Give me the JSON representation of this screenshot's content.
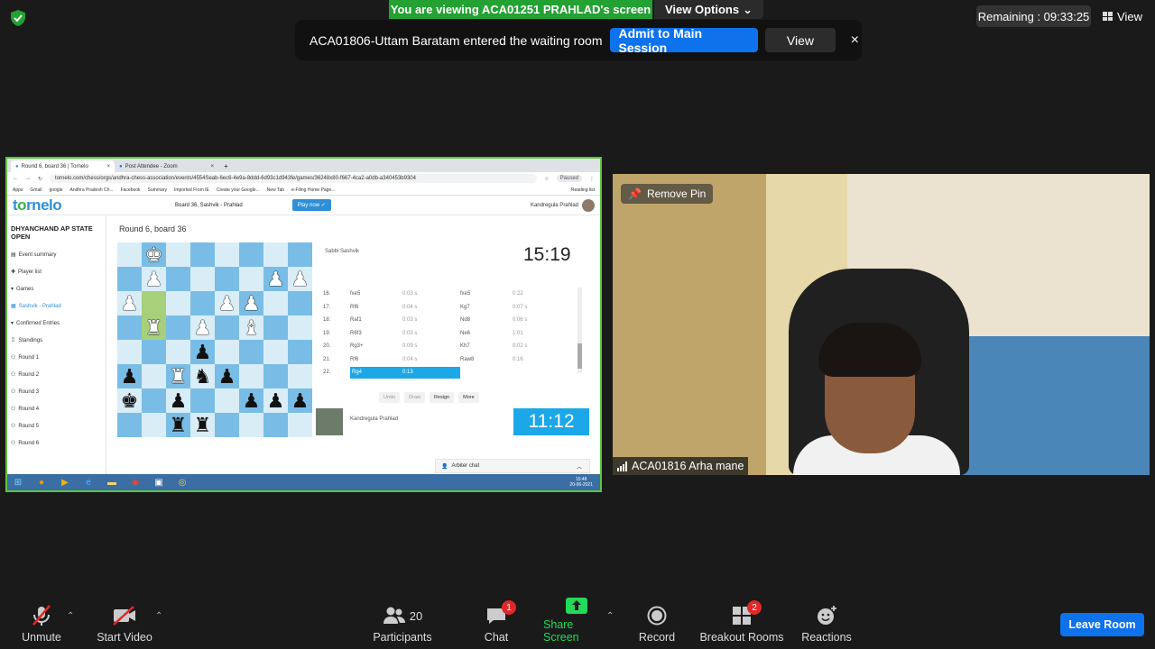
{
  "top": {
    "viewing_banner": "You are viewing ACA01251 PRAHLAD's screen",
    "view_options": "View Options",
    "remaining": "Remaining : 09:33:25",
    "view": "View"
  },
  "notice": {
    "message": "ACA01806-Uttam Baratam entered the waiting room",
    "admit": "Admit to Main Session",
    "view": "View",
    "close": "×"
  },
  "browser": {
    "tabs": [
      "Round 6, board 36 | Tornelo",
      "Post Attendee - Zoom"
    ],
    "tab_close": "×",
    "new_tab": "+",
    "url": "tornelo.com/chess/orgs/andhra-chess-association/events/4554Seab-6ec6-4e9a-8ddd-6d93c1d943fe/games/36248x80-f667-4ca2-a0db-a340453b9304",
    "paused": "Paused",
    "bookmarks": [
      "Apps",
      "Gmail",
      "google",
      "Andhra Pradesh Ch...",
      "Facebook",
      "Summary",
      "Imported From IE",
      "Create your Google...",
      "New Tab",
      "e-Filing Home Page...",
      "Reading list"
    ]
  },
  "site": {
    "logo_prefix": "t",
    "logo_o": "o",
    "logo_suffix": "rnelo",
    "board_title": "Board 36, Sashvik - Prahlad",
    "play_now": "Play now ✓",
    "user": "Kandregula Prahlad",
    "event": "DHYANCHAND AP STATE OPEN",
    "sidebar": [
      "Event summary",
      "Player list",
      "Games",
      "Sashvik - Prahlad",
      "Confirmed Entries",
      "Standings",
      "Round 1",
      "Round 2",
      "Round 3",
      "Round 4",
      "Round 5",
      "Round 6"
    ],
    "round_title": "Round 6, board 36",
    "opponent": "Sabbi Sashvik",
    "clock_top": "15:19",
    "me": "Kandregula Prahlad",
    "clock_bottom": "11:12",
    "controls": [
      "Undo",
      "Draw",
      "Resign",
      "More"
    ],
    "arbiter": "Arbiter chat",
    "moves": [
      {
        "n": "16.",
        "w": "fxe5",
        "wt": "0:03 s",
        "b": "fxe5",
        "bt": "0:22"
      },
      {
        "n": "17.",
        "w": "Rf6",
        "wt": "0:04 s",
        "b": "Kg7",
        "bt": "0:07 s"
      },
      {
        "n": "18.",
        "w": "Raf1",
        "wt": "0:03 s",
        "b": "Nd8",
        "bt": "0:06 s"
      },
      {
        "n": "19.",
        "w": "R6f3",
        "wt": "0:03 s",
        "b": "Ne6",
        "bt": "1:01"
      },
      {
        "n": "20.",
        "w": "Rg3+",
        "wt": "0:09 s",
        "b": "Kh7",
        "bt": "0:02 s"
      },
      {
        "n": "21.",
        "w": "Rf6",
        "wt": "0:04 s",
        "b": "Raw8",
        "bt": "0:16"
      },
      {
        "n": "22.",
        "w": "Rg4",
        "wt": "0:13",
        "b": "",
        "bt": ""
      }
    ],
    "taskbar_time": "15:48",
    "taskbar_date": "20-06-2021"
  },
  "video": {
    "remove_pin": "Remove Pin",
    "name": "ACA01816 Arha mane"
  },
  "toolbar": {
    "unmute": "Unmute",
    "start_video": "Start Video",
    "participants": "Participants",
    "participants_count": "20",
    "chat": "Chat",
    "chat_badge": "1",
    "share_screen": "Share Screen",
    "record": "Record",
    "breakout": "Breakout Rooms",
    "breakout_badge": "2",
    "reactions": "Reactions",
    "leave": "Leave Room"
  },
  "colors": {
    "zoom_blue": "#0e72ed",
    "share_green": "#23a133",
    "board_light": "#d9edf7",
    "board_dark": "#79bde6",
    "badge_red": "#e02828"
  }
}
